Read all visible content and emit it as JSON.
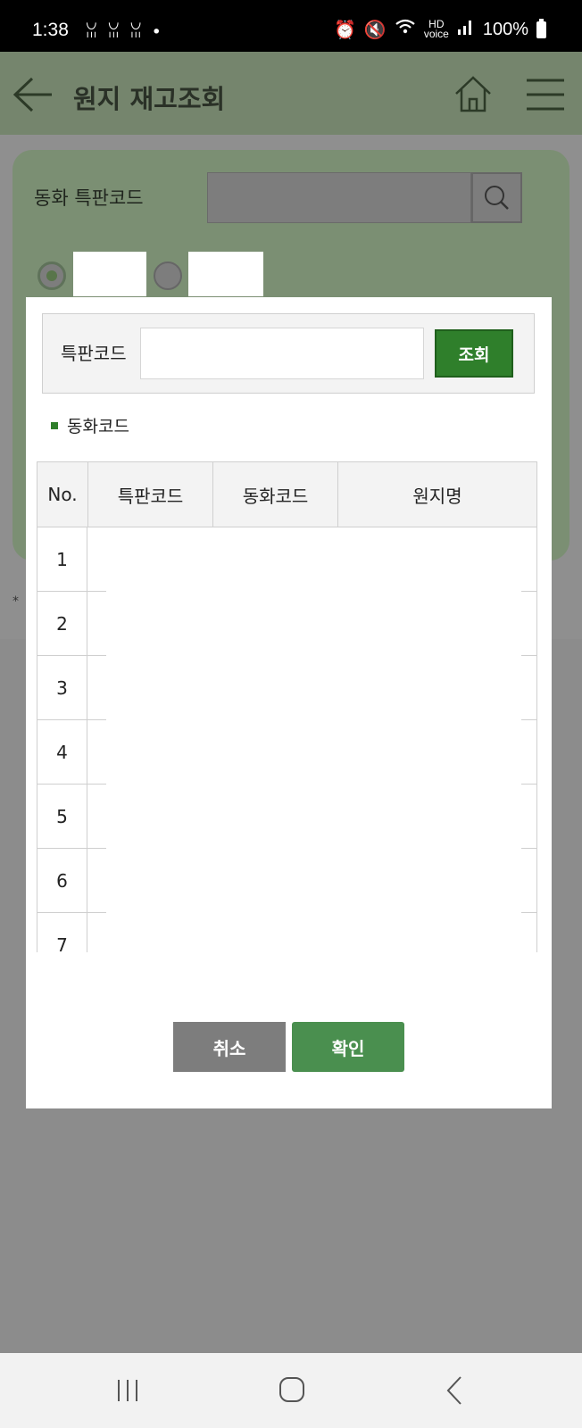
{
  "status_bar": {
    "time": "1:38",
    "notifications": "ꈍ ꈍ ꈍ •",
    "hd_label": "HD",
    "voice_label": "voice",
    "battery": "100%"
  },
  "header": {
    "title": "원지 재고조회",
    "back_icon": "arrow-left-icon",
    "home_icon": "home-icon",
    "menu_icon": "hamburger-menu-icon"
  },
  "background_form": {
    "code_label": "동화 특판코드",
    "search_icon": "search-icon"
  },
  "modal": {
    "search_label": "특판코드",
    "search_value": "",
    "search_button": "조회",
    "legend_label": "동화코드",
    "table": {
      "headers": [
        "No.",
        "특판코드",
        "동화코드",
        "원지명"
      ],
      "rows": [
        {
          "no": "1"
        },
        {
          "no": "2"
        },
        {
          "no": "3"
        },
        {
          "no": "4"
        },
        {
          "no": "5"
        },
        {
          "no": "6"
        },
        {
          "no": "7"
        }
      ]
    },
    "cancel_button": "취소",
    "confirm_button": "확인"
  },
  "colors": {
    "accent_green": "#2f7f2b",
    "confirm_green": "#4a8f4f",
    "cancel_gray": "#7d7d7d"
  }
}
